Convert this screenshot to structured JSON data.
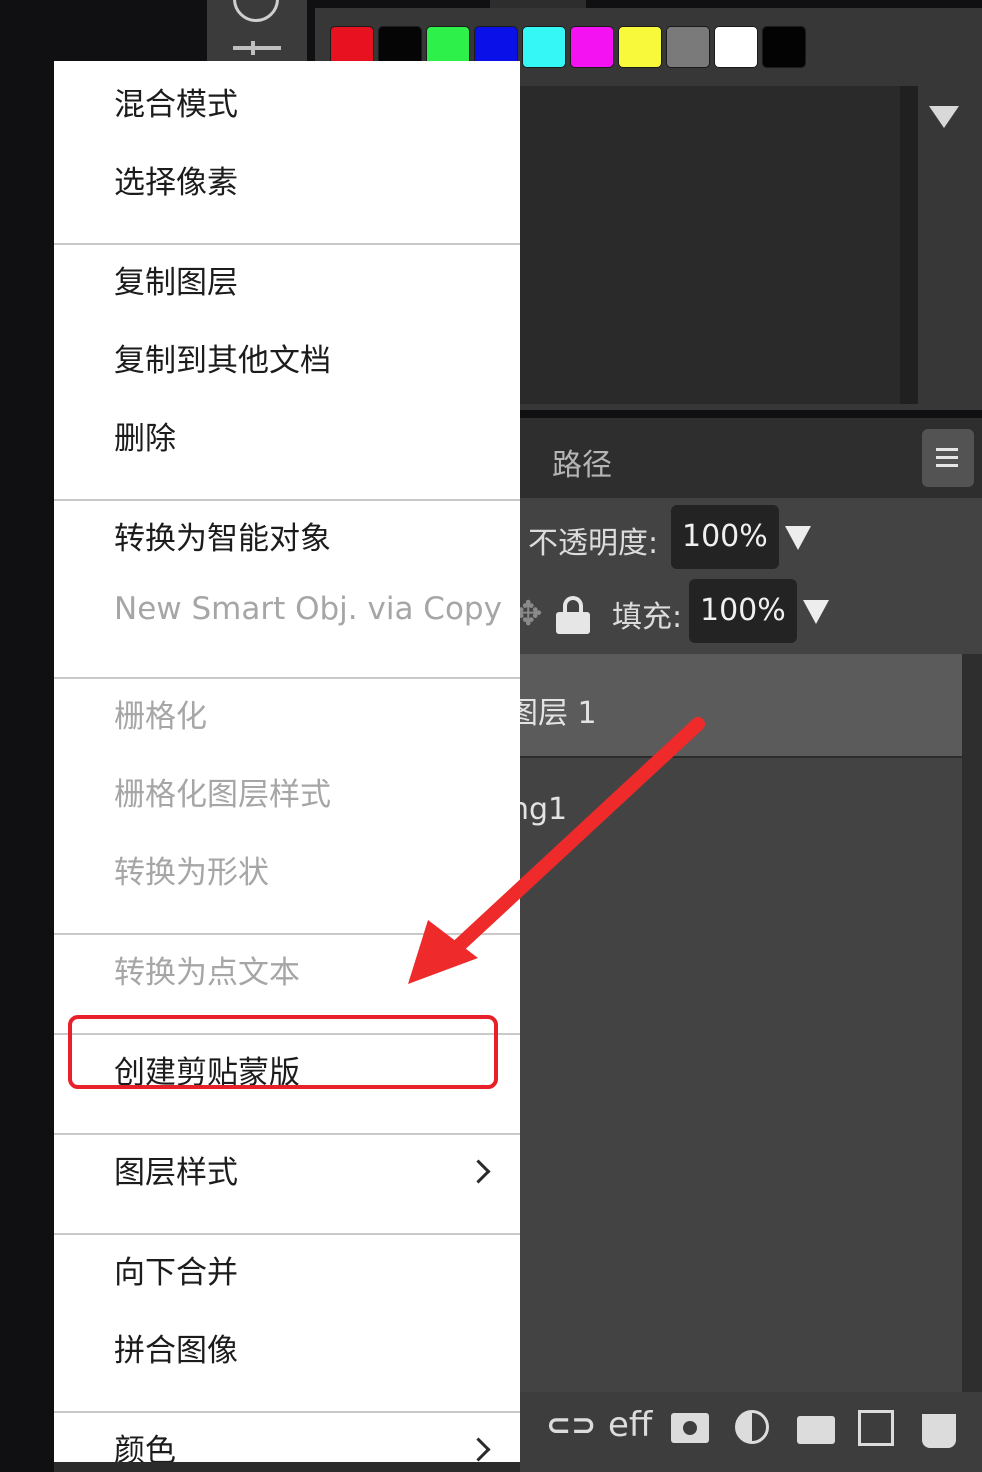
{
  "swatches": [
    "#e8111f",
    "#050505",
    "#2df04a",
    "#0a10e8",
    "#35f7f5",
    "#f512f2",
    "#f9f93c",
    "#7a7a7a",
    "#ffffff",
    "#030303"
  ],
  "layers_panel": {
    "tab_paths": "路径",
    "opacity_label": "不透明度:",
    "opacity_value": "100%",
    "fill_label": "填充:",
    "fill_value": "100%",
    "layers": [
      {
        "name_visible": "图层 1"
      },
      {
        "name_visible": "ng1"
      }
    ],
    "bottom_icons": [
      "link-icon",
      "effects-icon",
      "mask-icon",
      "adjustment-icon",
      "folder-icon",
      "new-layer-icon",
      "trash-icon"
    ],
    "effects_glyph": "eff"
  },
  "context_menu": {
    "groups": [
      [
        {
          "label": "混合模式",
          "enabled": true
        },
        {
          "label": "选择像素",
          "enabled": true
        }
      ],
      [
        {
          "label": "复制图层",
          "enabled": true
        },
        {
          "label": "复制到其他文档",
          "enabled": true
        },
        {
          "label": "删除",
          "enabled": true
        }
      ],
      [
        {
          "label": "转换为智能对象",
          "enabled": true
        },
        {
          "label": "New Smart Obj. via Copy",
          "enabled": false
        }
      ],
      [
        {
          "label": "栅格化",
          "enabled": false
        },
        {
          "label": "栅格化图层样式",
          "enabled": false
        },
        {
          "label": "转换为形状",
          "enabled": false
        }
      ],
      [
        {
          "label": "转换为点文本",
          "enabled": false
        }
      ],
      [
        {
          "label": "创建剪贴蒙版",
          "enabled": true,
          "highlighted": true
        }
      ],
      [
        {
          "label": "图层样式",
          "enabled": true,
          "submenu": true
        }
      ],
      [
        {
          "label": "向下合并",
          "enabled": true
        },
        {
          "label": "拼合图像",
          "enabled": true
        }
      ],
      [
        {
          "label": "颜色",
          "enabled": true,
          "submenu": true
        }
      ]
    ]
  },
  "annotation": {
    "color": "#ee2a2a"
  }
}
